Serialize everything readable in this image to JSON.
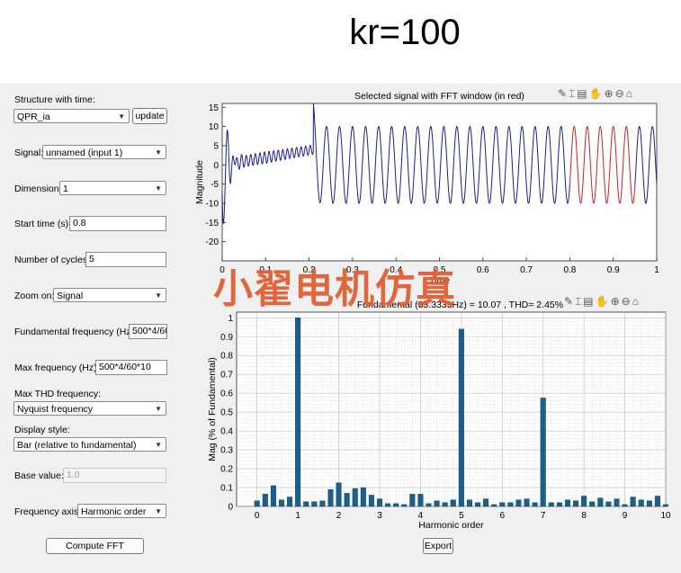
{
  "header": {
    "title": "kr=100"
  },
  "controls": {
    "structure_label": "Structure with time:",
    "structure_value": "QPR_ia",
    "update_label": "update",
    "signal_label": "Signal:",
    "signal_value": "unnamed (input 1)",
    "dimension_label": "Dimension:",
    "dimension_value": "1",
    "start_time_label": "Start time (s):",
    "start_time_value": "0.8",
    "cycles_label": "Number of cycles:",
    "cycles_value": "5",
    "zoom_label": "Zoom on:",
    "zoom_value": "Signal",
    "fund_freq_label": "Fundamental frequency (Hz):",
    "fund_freq_value": "500*4/60",
    "max_freq_label": "Max frequency (Hz):",
    "max_freq_value": "500*4/60*10",
    "max_thd_label": "Max THD frequency:",
    "max_thd_value": "Nyquist frequency",
    "display_style_label": "Display style:",
    "display_style_value": "Bar (relative to fundamental)",
    "base_value_label": "Base value:",
    "base_value_value": "1.0",
    "freq_axis_label": "Frequency axis:",
    "freq_axis_value": "Harmonic order",
    "compute_label": "Compute FFT",
    "export_label": "Export"
  },
  "toolbar_icons": [
    "pen-icon",
    "data-tip-icon",
    "brush-icon",
    "pan-hand-icon",
    "zoom-in-icon",
    "zoom-out-icon",
    "home-icon"
  ],
  "watermark": "小翟电机仿真",
  "colors": {
    "signal": "#1d1d8f",
    "fft_window": "#c0262b",
    "bar": "#1b5f8c"
  },
  "chart_data": [
    {
      "type": "line",
      "title": "Selected signal with FFT window (in red)",
      "xlabel": "Time",
      "ylabel": "Magnitude",
      "xlim": [
        0,
        1
      ],
      "ylim": [
        -25,
        16
      ],
      "xticks": [
        "0",
        "0.1",
        "0.2",
        "0.3",
        "0.4",
        "0.5",
        "0.6",
        "0.7",
        "0.8",
        "0.9",
        "1"
      ],
      "yticks": [
        "15",
        "10",
        "5",
        "0",
        "-5",
        "-10",
        "-15",
        "-20"
      ],
      "fundamental_hz": 33.33,
      "amplitude_after_step": 10,
      "step_time": 0.21,
      "fft_window": [
        0.8,
        0.95
      ],
      "grid": false
    },
    {
      "type": "bar",
      "title": "Fundamental (33.3333Hz) = 10.07 , THD= 2.45%",
      "xlabel": "Harmonic order",
      "ylabel": "Mag (% of Fundamental)",
      "xlim": [
        -0.5,
        10
      ],
      "ylim": [
        0,
        1.03
      ],
      "xticks": [
        "0",
        "1",
        "2",
        "3",
        "4",
        "5",
        "6",
        "7",
        "8",
        "9",
        "10"
      ],
      "yticks": [
        "1",
        "0.9",
        "0.8",
        "0.7",
        "0.6",
        "0.5",
        "0.4",
        "0.3",
        "0.2",
        "0.1",
        "0"
      ],
      "grid": true,
      "x": [
        0,
        0.2,
        0.4,
        0.6,
        0.8,
        1.0,
        1.2,
        1.4,
        1.6,
        1.8,
        2.0,
        2.2,
        2.4,
        2.6,
        2.8,
        3.0,
        3.2,
        3.4,
        3.6,
        3.8,
        4.0,
        4.2,
        4.4,
        4.6,
        4.8,
        5.0,
        5.2,
        5.4,
        5.6,
        5.8,
        6.0,
        6.2,
        6.4,
        6.6,
        6.8,
        7.0,
        7.2,
        7.4,
        7.6,
        7.8,
        8.0,
        8.2,
        8.4,
        8.6,
        8.8,
        9.0,
        9.2,
        9.4,
        9.6,
        9.8,
        10.0
      ],
      "values": [
        0.03,
        0.065,
        0.11,
        0.035,
        0.05,
        1.0,
        0.025,
        0.025,
        0.03,
        0.09,
        0.125,
        0.07,
        0.095,
        0.1,
        0.06,
        0.04,
        0.015,
        0.015,
        0.01,
        0.065,
        0.065,
        0.015,
        0.03,
        0.02,
        0.035,
        0.94,
        0.035,
        0.02,
        0.04,
        0.01,
        0.02,
        0.02,
        0.035,
        0.04,
        0.02,
        0.575,
        0.02,
        0.02,
        0.035,
        0.03,
        0.055,
        0.025,
        0.045,
        0.025,
        0.04,
        0.01,
        0.05,
        0.035,
        0.03,
        0.055,
        0.01
      ]
    }
  ]
}
